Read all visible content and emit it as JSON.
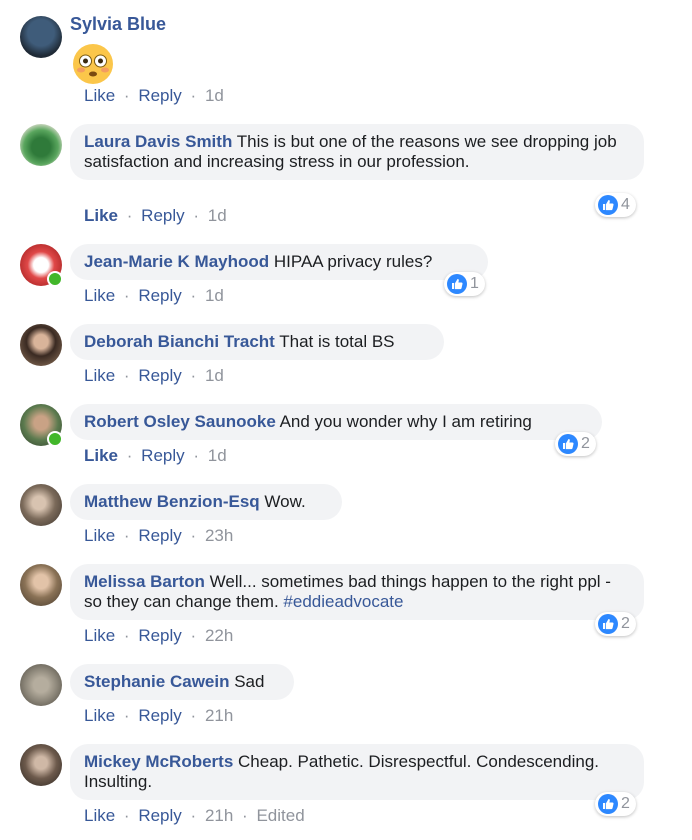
{
  "comments": [
    {
      "name": "Sylvia Blue",
      "text": "",
      "emoji": "flushed-face-emoji",
      "actions": {
        "like": "Like",
        "reply": "Reply",
        "time": "1d"
      },
      "avatar_color": "#2a3b4c"
    },
    {
      "name": "Laura Davis Smith",
      "text": "This is but one of the reasons we see dropping job satisfaction and increasing stress in our profession.",
      "actions": {
        "like": "Like",
        "reply": "Reply",
        "time": "1d",
        "liked": true
      },
      "reactions": "4",
      "avatar_color": "#3d8c44"
    },
    {
      "name": "Jean-Marie K Mayhood",
      "text": "HIPAA privacy rules?",
      "actions": {
        "like": "Like",
        "reply": "Reply",
        "time": "1d"
      },
      "reactions": "1",
      "online": true,
      "avatar_color": "#c43b3b"
    },
    {
      "name": "Deborah Bianchi Tracht",
      "text": "That is total BS",
      "actions": {
        "like": "Like",
        "reply": "Reply",
        "time": "1d"
      },
      "avatar_color": "#6b5443"
    },
    {
      "name": "Robert Osley Saunooke",
      "text": "And you wonder why I am retiring",
      "actions": {
        "like": "Like",
        "reply": "Reply",
        "time": "1d",
        "liked": true
      },
      "reactions": "2",
      "online": true,
      "avatar_color": "#5b7a4e"
    },
    {
      "name": "Matthew Benzion-Esq",
      "text": "Wow.",
      "actions": {
        "like": "Like",
        "reply": "Reply",
        "time": "23h"
      },
      "avatar_color": "#7b6a5a"
    },
    {
      "name": "Melissa Barton",
      "text": "Well... sometimes bad things happen to the right ppl - so they can change them.",
      "hashtag": "#eddieadvocate",
      "actions": {
        "like": "Like",
        "reply": "Reply",
        "time": "22h"
      },
      "reactions": "2",
      "avatar_color": "#8a7256"
    },
    {
      "name": "Stephanie Cawein",
      "text": "Sad",
      "actions": {
        "like": "Like",
        "reply": "Reply",
        "time": "21h"
      },
      "avatar_color": "#8b8578"
    },
    {
      "name": "Mickey McRoberts",
      "text": "Cheap. Pathetic. Disrespectful. Condescending. Insulting.",
      "actions": {
        "like": "Like",
        "reply": "Reply",
        "time": "21h",
        "edited": "Edited"
      },
      "reactions": "2",
      "avatar_color": "#6d5a4c"
    }
  ],
  "separator": "·",
  "colors": {
    "link": "#385898",
    "bubble": "#f2f3f5",
    "meta": "#90949c",
    "like_blue": "#2d88ff",
    "online": "#42b72a"
  }
}
